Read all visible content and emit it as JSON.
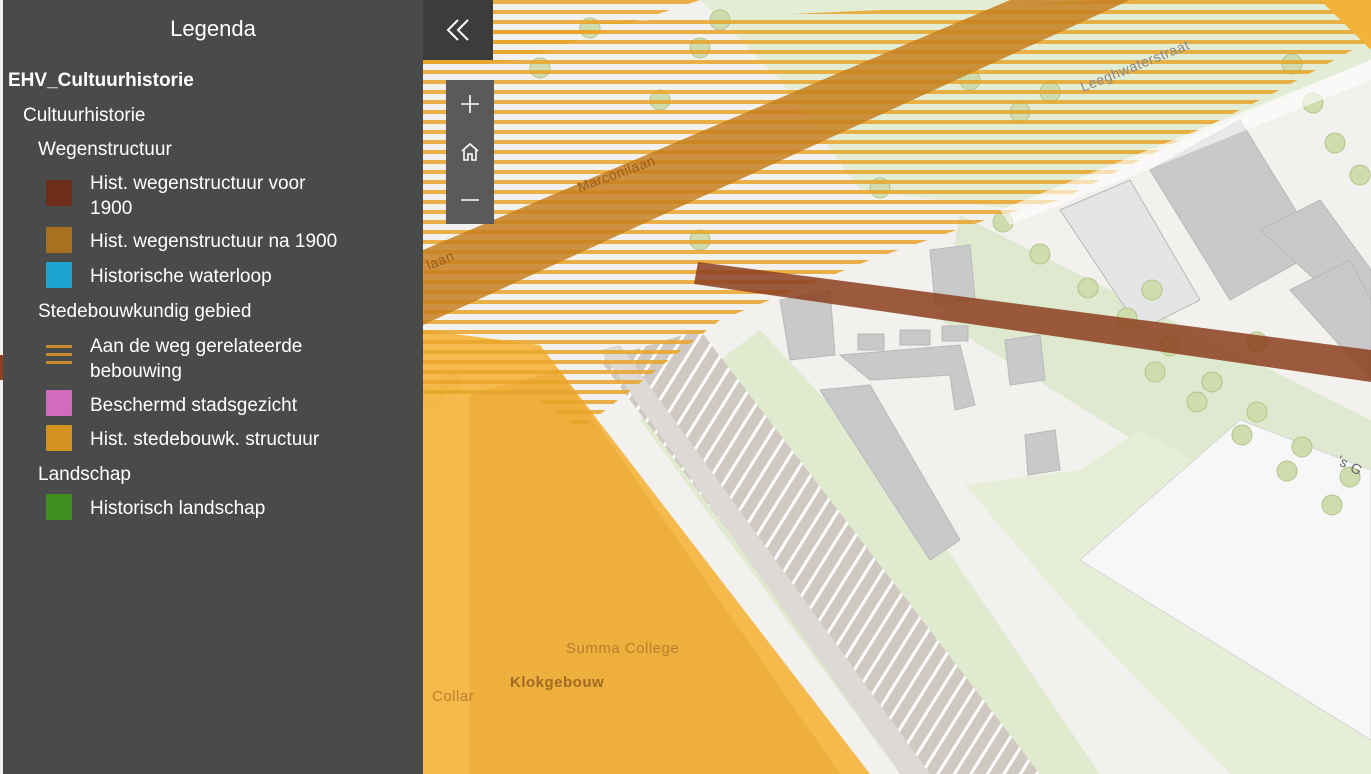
{
  "legend": {
    "title": "Legenda",
    "layer": "EHV_Cultuurhistorie",
    "group": "Cultuurhistorie",
    "sections": [
      {
        "heading": "Wegenstructuur",
        "items": [
          {
            "label_line1": "Hist. wegenstructuur voor",
            "label_line2": "1900",
            "color": "#6e2c1a"
          },
          {
            "label_line1": "Hist. wegenstructuur na 1900",
            "color": "#a8701f"
          },
          {
            "label_line1": "Historische waterloop",
            "color": "#1ea4cf"
          }
        ]
      },
      {
        "heading": "Stedebouwkundig gebied",
        "items": [
          {
            "label_line1": "Aan de weg gerelateerde",
            "label_line2": "bebouwing",
            "color": "#c58a2a",
            "icon": "hatched-lines-icon"
          },
          {
            "label_line1": "Beschermd stadsgezicht",
            "color": "#d06bbd"
          },
          {
            "label_line1": "Hist. stedebouwk. structuur",
            "color": "#d49220"
          }
        ]
      },
      {
        "heading": "Landschap",
        "items": [
          {
            "label_line1": "Historisch landschap",
            "color": "#3f8f1f"
          }
        ]
      }
    ]
  },
  "controls": {
    "collapse_icon": "double-chevron-left-icon",
    "zoom_in_icon": "plus-icon",
    "home_icon": "home-icon",
    "zoom_out_icon": "minus-icon"
  },
  "map": {
    "street_labels": [
      "Leeghwaterstraat",
      "Marconilaan",
      "'s G",
      "laan"
    ],
    "place_labels": [
      "Summa College",
      "Klokgebouw",
      "Collar"
    ]
  }
}
